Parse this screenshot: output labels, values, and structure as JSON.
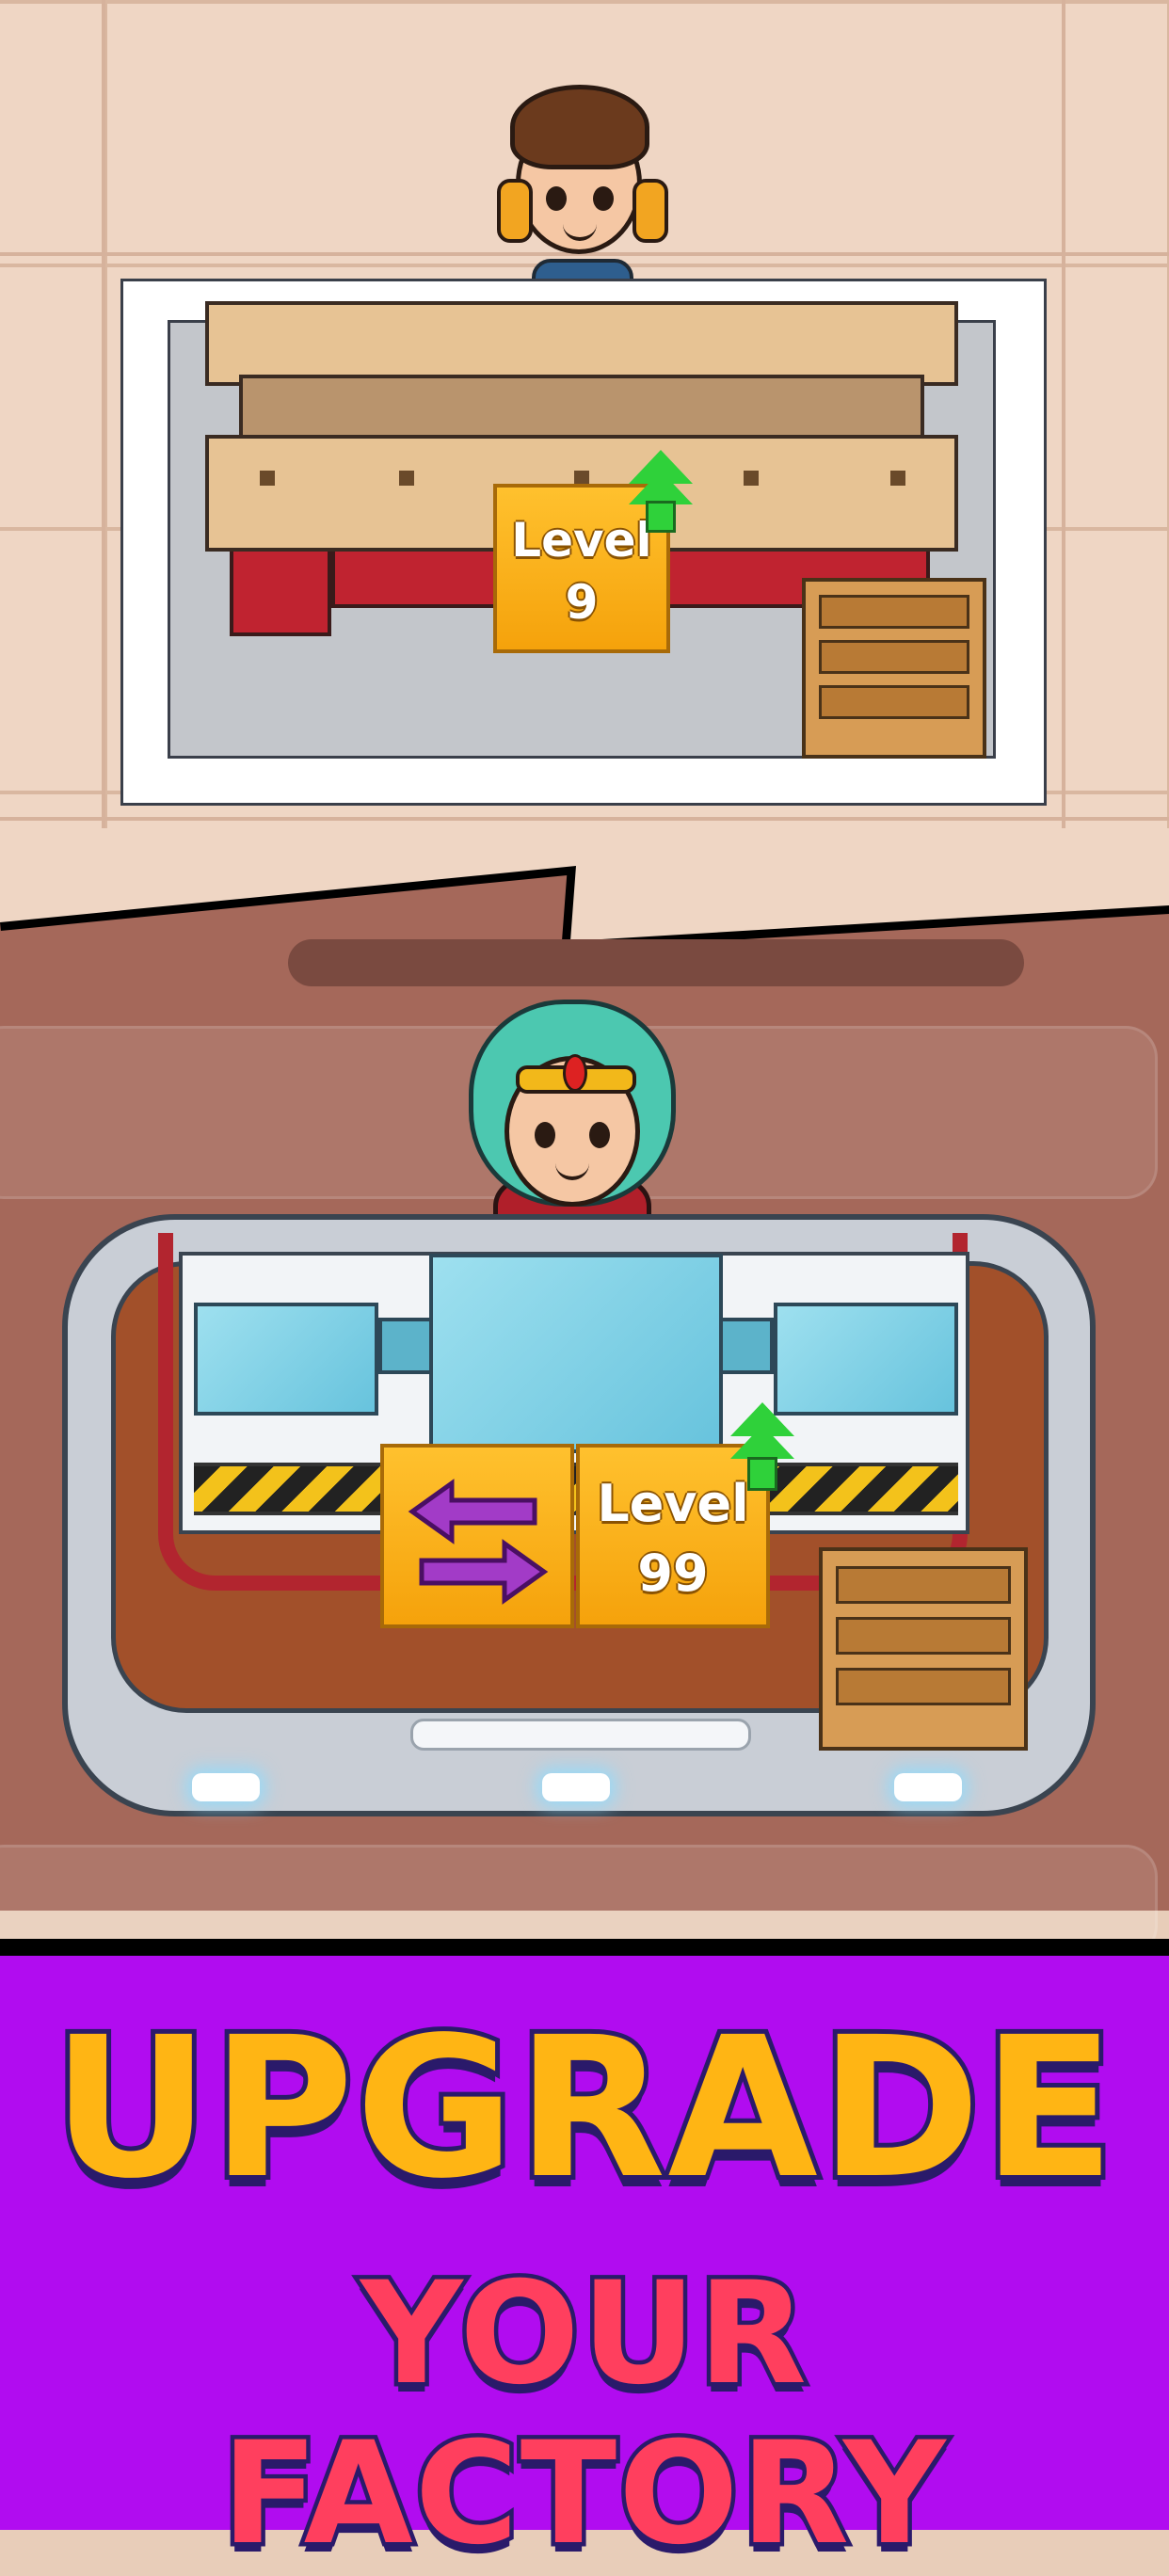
{
  "scene_top": {
    "upgrade_badge": {
      "label": "Level",
      "value": "9"
    }
  },
  "scene_bottom": {
    "upgrade_badge": {
      "label": "Level",
      "value": "99"
    }
  },
  "banner": {
    "line1": "UPGRADE",
    "line2": "YOUR FACTORY"
  },
  "colors": {
    "banner_bg": "#b10cf0",
    "headline1": "#ffb514",
    "headline2": "#ff3f5e",
    "badge": "#f5a20b",
    "arrow_up": "#2fd13a",
    "swap_arrows": "#a23bc7"
  },
  "icons": [
    "worker-avatar",
    "hero-avatar",
    "upgrade-arrow-icon",
    "swap-arrows-icon",
    "crate-icon"
  ]
}
